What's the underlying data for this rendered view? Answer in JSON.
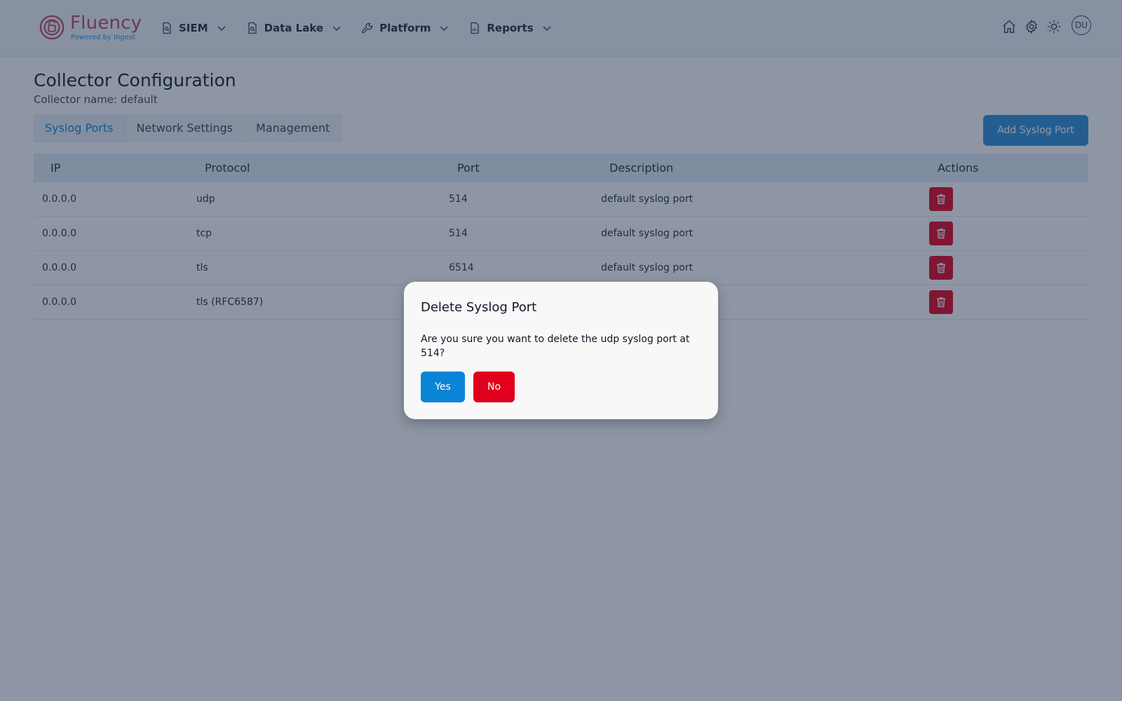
{
  "brand": {
    "name": "Fluency",
    "tagline": "Powered by Ingest",
    "color": "#c0415a"
  },
  "nav": {
    "items": [
      {
        "label": "SIEM",
        "icon": "search-file-icon"
      },
      {
        "label": "Data Lake",
        "icon": "search-file-icon"
      },
      {
        "label": "Platform",
        "icon": "wrench-icon"
      },
      {
        "label": "Reports",
        "icon": "report-file-icon"
      }
    ],
    "right_icons": [
      "home-icon",
      "gear-icon",
      "sun-icon"
    ],
    "avatar": "DU"
  },
  "page": {
    "title": "Collector Configuration",
    "subtitle": "Collector name: default",
    "tabs": [
      "Syslog Ports",
      "Network Settings",
      "Management"
    ],
    "active_tab": "Syslog Ports",
    "add_button": "Add Syslog Port"
  },
  "table": {
    "headers": {
      "ip": "IP",
      "protocol": "Protocol",
      "port": "Port",
      "description": "Description",
      "actions": "Actions"
    },
    "rows": [
      {
        "ip": "0.0.0.0",
        "protocol": "udp",
        "port": "514",
        "description": "default syslog port"
      },
      {
        "ip": "0.0.0.0",
        "protocol": "tcp",
        "port": "514",
        "description": "default syslog port"
      },
      {
        "ip": "0.0.0.0",
        "protocol": "tls",
        "port": "6514",
        "description": "default syslog port"
      },
      {
        "ip": "0.0.0.0",
        "protocol": "tls (RFC6587)",
        "port": "",
        "description": ""
      }
    ],
    "delete_icon": "trash-icon"
  },
  "modal": {
    "title": "Delete Syslog Port",
    "message": "Are you sure you want to delete the udp syslog port at 514?",
    "yes": "Yes",
    "no": "No"
  },
  "colors": {
    "primary": "#0a84d6",
    "danger": "#e0001b"
  }
}
